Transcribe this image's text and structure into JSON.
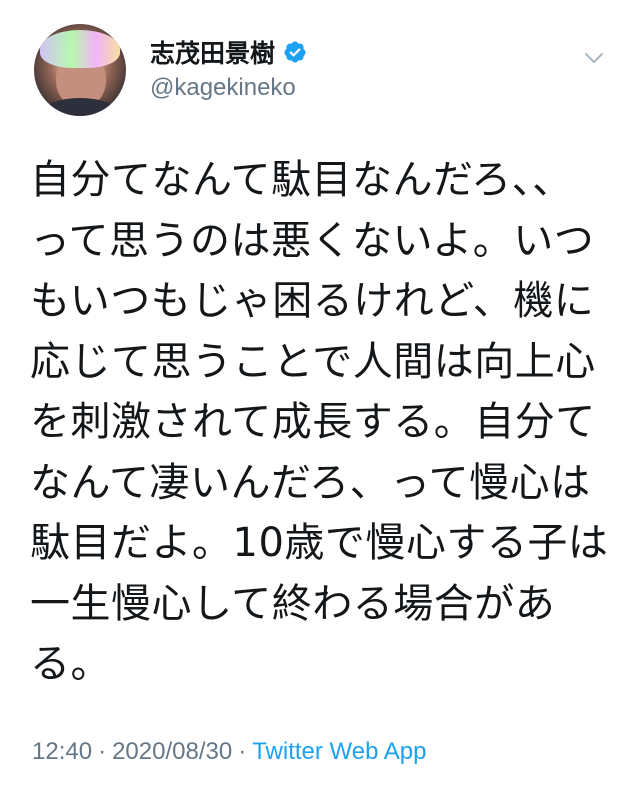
{
  "user": {
    "display_name": "志茂田景樹",
    "handle": "@kagekineko",
    "verified": true
  },
  "tweet": {
    "lines": [
      "自分てなんて駄目なんだろ、、",
      "って思うのは悪くないよ。いつ",
      "もいつもじゃ困るけれど、機に",
      "応じて思うことで人間は向上心",
      "を刺激されて成長する。自分て",
      "なんて凄いんだろ、って慢心は",
      "駄目だよ。10歳で慢心する子は",
      "一生慢心して終わる場合があ",
      "る。"
    ]
  },
  "meta": {
    "time": "12:40",
    "separator": "·",
    "date": "2020/08/30",
    "source": "Twitter Web App"
  },
  "colors": {
    "text": "#14171a",
    "secondary": "#657786",
    "link": "#1da1f2",
    "verified": "#1da1f2"
  },
  "icons": {
    "verified": "verified-badge-icon",
    "menu": "chevron-down-icon"
  }
}
